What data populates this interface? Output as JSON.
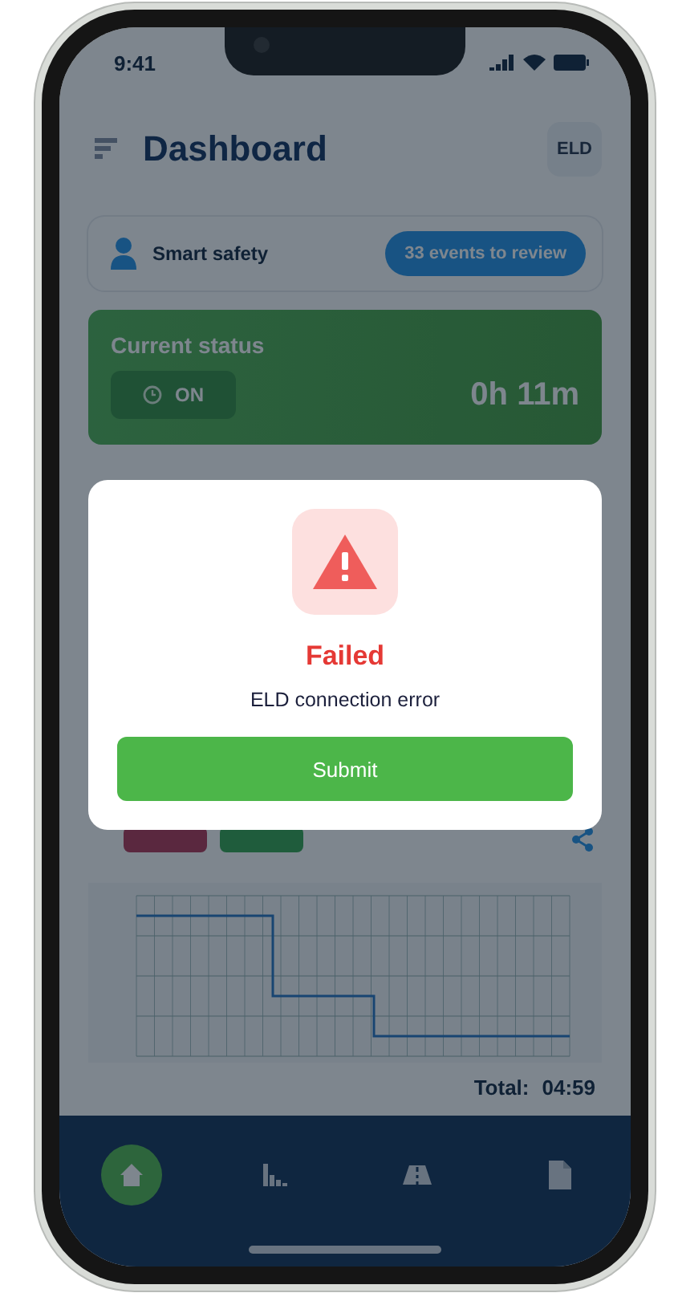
{
  "status_bar": {
    "time": "9:41"
  },
  "header": {
    "title": "Dashboard",
    "badge": "ELD"
  },
  "smart_safety": {
    "label": "Smart safety",
    "button": "33 events to review"
  },
  "current_status": {
    "title": "Current status",
    "state": "ON",
    "duration": "0h 11m"
  },
  "log": {
    "total_label": "Total:",
    "total_value": "04:59"
  },
  "nav": [
    {
      "kind": "home",
      "selected": true
    },
    {
      "kind": "chart",
      "selected": false
    },
    {
      "kind": "road",
      "selected": false
    },
    {
      "kind": "document",
      "selected": false
    }
  ],
  "dialog": {
    "title": "Failed",
    "message": "ELD connection error",
    "button": "Submit"
  }
}
